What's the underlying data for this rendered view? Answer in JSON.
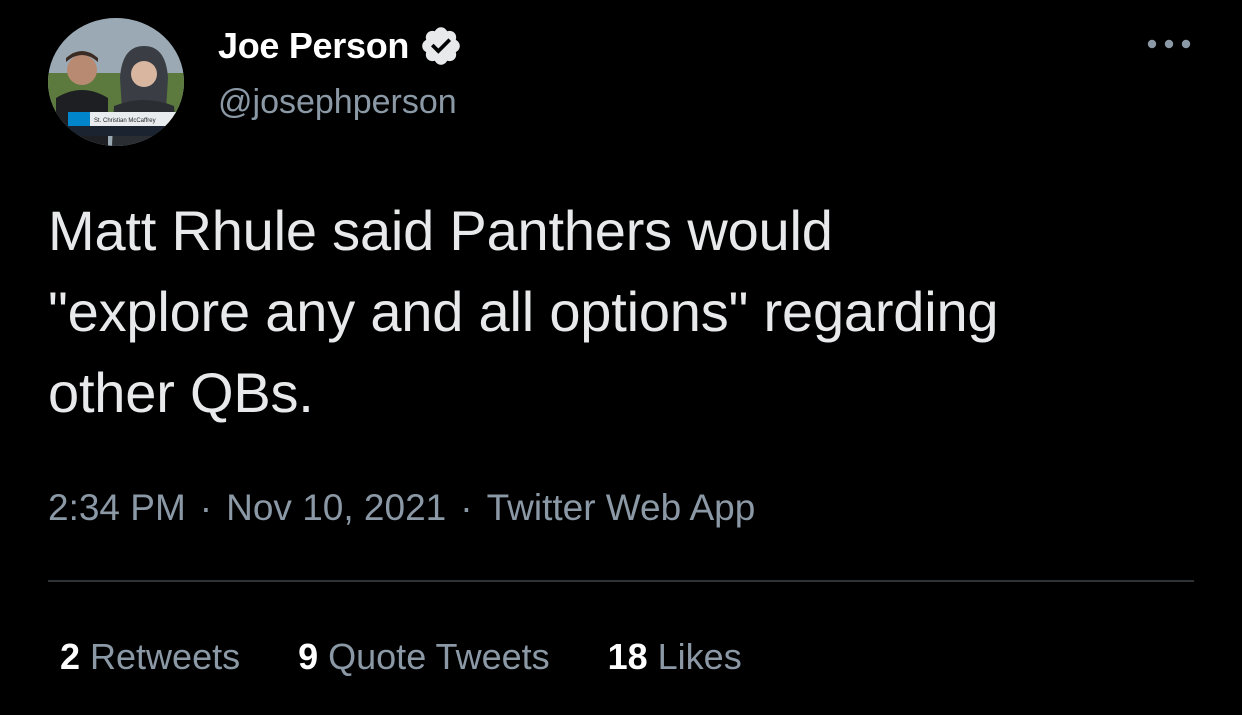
{
  "author": {
    "display_name": "Joe Person",
    "handle": "@josephperson",
    "verified": true,
    "avatar_caption": "St. Christian McCaffrey"
  },
  "tweet": {
    "text_lines": [
      "Matt Rhule said Panthers would",
      "\"explore any and all options\" regarding",
      "other QBs."
    ]
  },
  "meta": {
    "time": "2:34 PM",
    "date": "Nov 10, 2021",
    "source": "Twitter Web App",
    "separator": "·"
  },
  "stats": [
    {
      "count": "2",
      "label": "Retweets"
    },
    {
      "count": "9",
      "label": "Quote Tweets"
    },
    {
      "count": "18",
      "label": "Likes"
    }
  ],
  "icons": {
    "verified": "verified-badge-icon",
    "more": "more-options-icon"
  },
  "colors": {
    "background": "#000000",
    "primary_text": "#e7e9ea",
    "secondary_text": "#8b98a5",
    "divider": "#2f3336"
  }
}
